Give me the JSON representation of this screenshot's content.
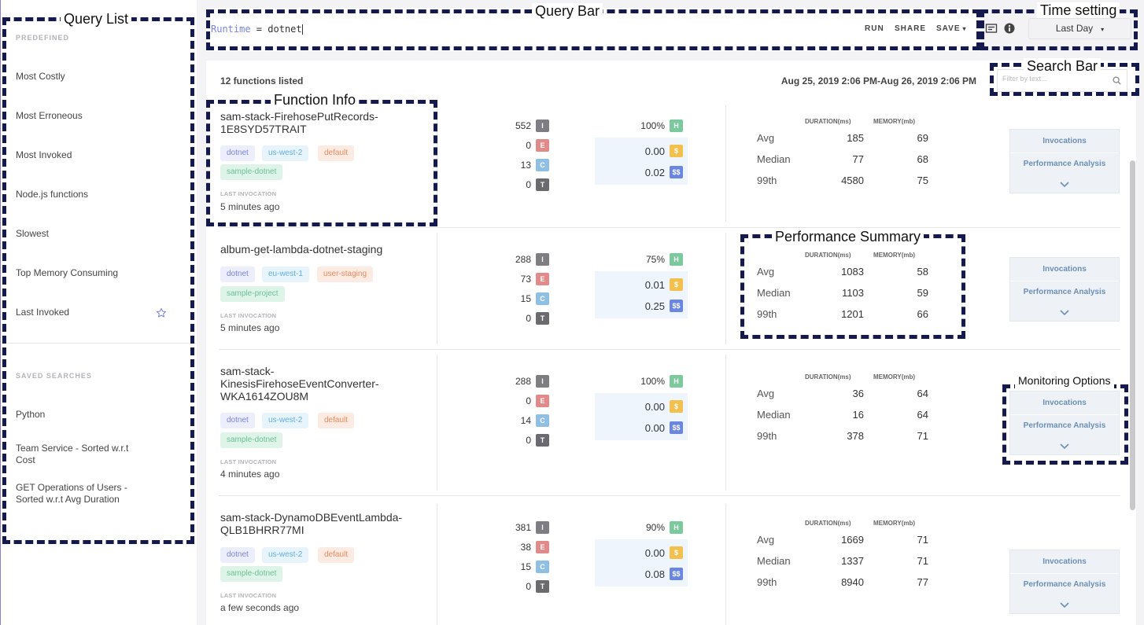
{
  "sidebar": {
    "predefined_label": "PREDEFINED",
    "items": [
      "Most Costly",
      "Most Erroneous",
      "Most Invoked",
      "Node.js functions",
      "Slowest",
      "Top Memory Consuming",
      "Last Invoked"
    ],
    "saved_label": "SAVED SEARCHES",
    "saved": [
      "Python",
      "Team Service - Sorted w.r.t Cost",
      "GET Operations of Users - Sorted w.r.t Avg Duration"
    ]
  },
  "query_bar": {
    "key": "Runtime",
    "operator": " = ",
    "value": "dotnet",
    "run": "RUN",
    "share": "SHARE",
    "save": "SAVE"
  },
  "time_setting": {
    "value": "Last Day"
  },
  "main": {
    "count": "12 functions listed",
    "range": "Aug 25, 2019 2:06 PM-Aug 26, 2019 2:06 PM",
    "search_placeholder": "Filter by text..."
  },
  "columns": {
    "duration": "DURATION(ms)",
    "memory": "MEMORY(mb)"
  },
  "stat_labels": {
    "i": "I",
    "e": "E",
    "c": "C",
    "t": "T",
    "h": "H",
    "cost1": "$",
    "cost2": "$$"
  },
  "perf_labels": {
    "avg": "Avg",
    "median": "Median",
    "p99": "99th"
  },
  "monitor": {
    "invocations": "Invocations",
    "perf": "Performance Analysis"
  },
  "functions": [
    {
      "name": "sam-stack-FirehosePutRecords-1E8SYD57TRAIT",
      "tags": [
        "dotnet",
        "us-west-2",
        "default",
        "sample-dotnet"
      ],
      "last_label": "LAST INVOCATION",
      "last_value": "5 minutes ago",
      "invocations": "552",
      "errors": "0",
      "cold": "13",
      "timeouts": "0",
      "health": "100%",
      "cost1": "0.00",
      "cost2": "0.02",
      "avg_dur": "185",
      "avg_mem": "69",
      "med_dur": "77",
      "med_mem": "68",
      "p99_dur": "4580",
      "p99_mem": "75"
    },
    {
      "name": "album-get-lambda-dotnet-staging",
      "tags": [
        "dotnet",
        "eu-west-1",
        "user-staging",
        "sample-project"
      ],
      "last_label": "LAST INVOCATION",
      "last_value": "5 minutes ago",
      "invocations": "288",
      "errors": "73",
      "cold": "15",
      "timeouts": "0",
      "health": "75%",
      "cost1": "0.01",
      "cost2": "0.25",
      "avg_dur": "1083",
      "avg_mem": "58",
      "med_dur": "1103",
      "med_mem": "59",
      "p99_dur": "1201",
      "p99_mem": "66"
    },
    {
      "name": "sam-stack-KinesisFirehoseEventConverter-WKA1614ZOU8M",
      "tags": [
        "dotnet",
        "us-west-2",
        "default",
        "sample-dotnet"
      ],
      "last_label": "LAST INVOCATION",
      "last_value": "4 minutes ago",
      "invocations": "288",
      "errors": "0",
      "cold": "14",
      "timeouts": "0",
      "health": "100%",
      "cost1": "0.00",
      "cost2": "0.00",
      "avg_dur": "36",
      "avg_mem": "64",
      "med_dur": "16",
      "med_mem": "64",
      "p99_dur": "378",
      "p99_mem": "71"
    },
    {
      "name": "sam-stack-DynamoDBEventLambda-QLB1BHRR77MI",
      "tags": [
        "dotnet",
        "us-west-2",
        "default",
        "sample-dotnet"
      ],
      "last_label": "LAST INVOCATION",
      "last_value": "a few seconds ago",
      "invocations": "381",
      "errors": "38",
      "cold": "15",
      "timeouts": "0",
      "health": "90%",
      "cost1": "0.00",
      "cost2": "0.08",
      "avg_dur": "1669",
      "avg_mem": "71",
      "med_dur": "1337",
      "med_mem": "71",
      "p99_dur": "8940",
      "p99_mem": "77"
    }
  ],
  "annotations": {
    "query_list": "Query List",
    "query_bar": "Query Bar",
    "time_setting": "Time setting",
    "search_bar": "Search Bar",
    "function_info": "Function Info",
    "performance_summary": "Performance Summary",
    "monitoring_options": "Monitoring Options"
  }
}
